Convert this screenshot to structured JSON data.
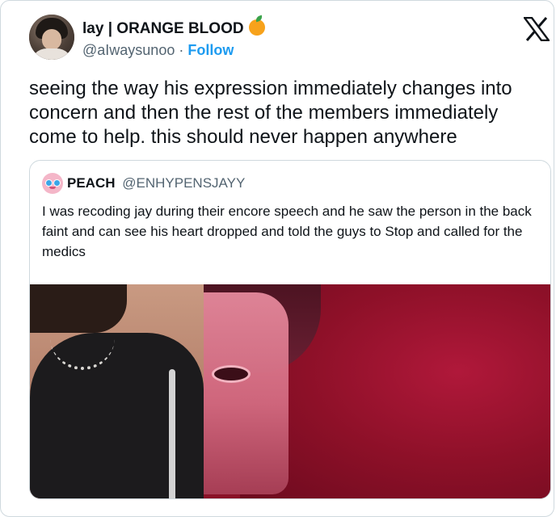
{
  "tweet": {
    "author_name": "lay | ORANGE BLOOD",
    "author_handle": "@aIwaysunoo",
    "separator": "·",
    "follow_label": "Follow",
    "text": "seeing the way his expression immediately changes into concern and then the rest of the members immediately come to help. this should never happen anywhere"
  },
  "quote": {
    "author_name": "PEACH",
    "author_handle": "@ENHYPENSJAYY",
    "text": "I was recoding jay during their encore speech and he saw the person in the back faint and can see his heart dropped and told the guys to Stop and called for the medics"
  },
  "icons": {
    "name_emoji": "orange-emoji-icon",
    "platform_logo": "x-logo-icon"
  },
  "colors": {
    "text": "#0f1419",
    "secondary_text": "#536471",
    "accent": "#1d9bf0",
    "border": "#cfd9de"
  }
}
